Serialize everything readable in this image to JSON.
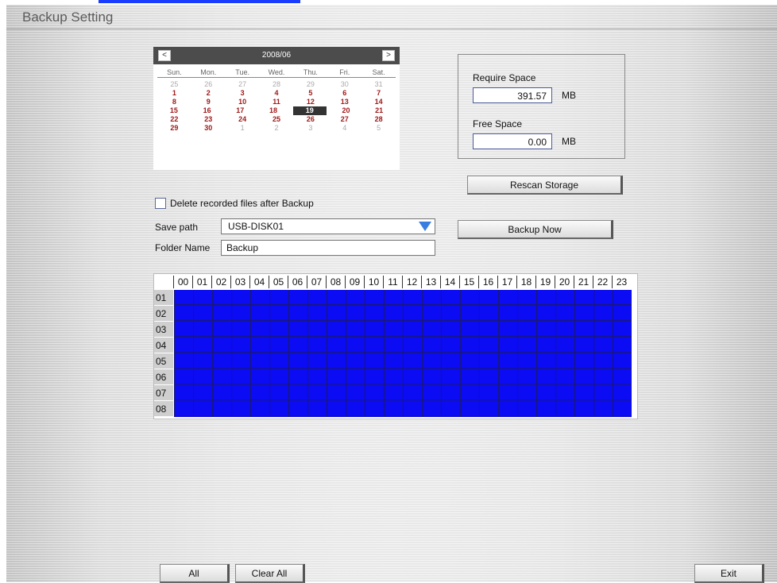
{
  "window": {
    "title": "Backup Setting"
  },
  "calendar": {
    "month": "2008/06",
    "weekdays": [
      "Sun.",
      "Mon.",
      "Tue.",
      "Wed.",
      "Thu.",
      "Fri.",
      "Sat."
    ],
    "weeks": [
      [
        [
          "25",
          "other"
        ],
        [
          "26",
          "other"
        ],
        [
          "27",
          "other"
        ],
        [
          "28",
          "other"
        ],
        [
          "29",
          "other"
        ],
        [
          "30",
          "other"
        ],
        [
          "31",
          "other"
        ]
      ],
      [
        [
          "1",
          "cur"
        ],
        [
          "2",
          "cur"
        ],
        [
          "3",
          "cur"
        ],
        [
          "4",
          "cur"
        ],
        [
          "5",
          "cur"
        ],
        [
          "6",
          "cur"
        ],
        [
          "7",
          "cur"
        ]
      ],
      [
        [
          "8",
          "cur"
        ],
        [
          "9",
          "cur"
        ],
        [
          "10",
          "cur"
        ],
        [
          "11",
          "cur"
        ],
        [
          "12",
          "cur"
        ],
        [
          "13",
          "cur"
        ],
        [
          "14",
          "cur"
        ]
      ],
      [
        [
          "15",
          "cur"
        ],
        [
          "16",
          "cur"
        ],
        [
          "17",
          "cur"
        ],
        [
          "18",
          "cur"
        ],
        [
          "19",
          "sel"
        ],
        [
          "20",
          "cur"
        ],
        [
          "21",
          "cur"
        ]
      ],
      [
        [
          "22",
          "cur"
        ],
        [
          "23",
          "cur"
        ],
        [
          "24",
          "cur"
        ],
        [
          "25",
          "cur"
        ],
        [
          "26",
          "cur"
        ],
        [
          "27",
          "cur"
        ],
        [
          "28",
          "cur"
        ]
      ],
      [
        [
          "29",
          "cur"
        ],
        [
          "30",
          "cur"
        ],
        [
          "1",
          "other"
        ],
        [
          "2",
          "other"
        ],
        [
          "3",
          "other"
        ],
        [
          "4",
          "other"
        ],
        [
          "5",
          "other"
        ]
      ]
    ],
    "prev_label": "<",
    "next_label": ">"
  },
  "storage": {
    "require_label": "Require Space",
    "require_value": "391.57",
    "free_label": "Free Space",
    "free_value": "0.00",
    "unit": "MB",
    "rescan_label": "Rescan Storage"
  },
  "options": {
    "delete_label": "Delete recorded files after Backup",
    "save_path_label": "Save path",
    "save_path_value": "USB-DISK01",
    "folder_label": "Folder Name",
    "folder_value": "Backup",
    "backup_label": "Backup Now"
  },
  "schedule": {
    "hours": [
      "00",
      "01",
      "02",
      "03",
      "04",
      "05",
      "06",
      "07",
      "08",
      "09",
      "10",
      "11",
      "12",
      "13",
      "14",
      "15",
      "16",
      "17",
      "18",
      "19",
      "20",
      "21",
      "22",
      "23"
    ],
    "days": [
      "01",
      "02",
      "03",
      "04",
      "05",
      "06",
      "07",
      "08"
    ]
  },
  "footer": {
    "all_label": "All",
    "clear_label": "Clear All",
    "exit_label": "Exit"
  }
}
